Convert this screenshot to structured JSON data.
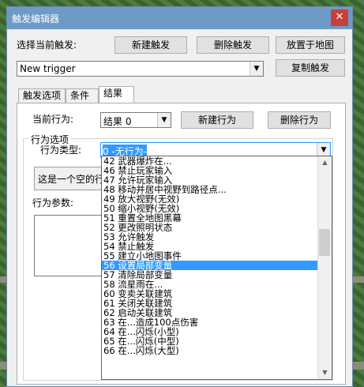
{
  "window": {
    "title": "触发编辑器",
    "close_glyph": "✕"
  },
  "header": {
    "select_trigger_label": "选择当前触发:",
    "new_trigger_button": "新建触发",
    "delete_trigger_button": "删除触发",
    "place_on_map_button": "放置于地图",
    "copy_trigger_button": "复制触发",
    "trigger_value": "New trigger"
  },
  "tabs": [
    {
      "label": "触发选项"
    },
    {
      "label": "条件"
    },
    {
      "label": "结果"
    }
  ],
  "results": {
    "current_action_label": "当前行为:",
    "current_action_value": "结果 0",
    "new_action_button": "新建行为",
    "delete_action_button": "删除行为",
    "group_label": "行为选项",
    "action_type_label": "行为类型:",
    "action_type_value": "0 -无行为-",
    "description_text": "这是一个空的行",
    "params_label": "行为参数:"
  },
  "dropdown_items": [
    "42 武器爆炸在...",
    "46 禁止玩家输入",
    "47 允许玩家输入",
    "48 移动并居中视野到路径点...",
    "49 放大视野(无效)",
    "50 缩小视野(无效)",
    "51 重置全地图黑幕",
    "52 更改照明状态",
    "53 允许触发",
    "54 禁止触发",
    "55 建立小地图事件",
    "56 设置局部变量",
    "57 清除局部变量",
    "58 流星雨在...",
    "60 变卖关联建筑",
    "61 关闭关联建筑",
    "62 启动关联建筑",
    "63 在...造成100点伤害",
    "64 在...闪烁(小型)",
    "65 在...闪烁(中型)",
    "66 在...闪烁(大型)"
  ],
  "selected_index": 11
}
